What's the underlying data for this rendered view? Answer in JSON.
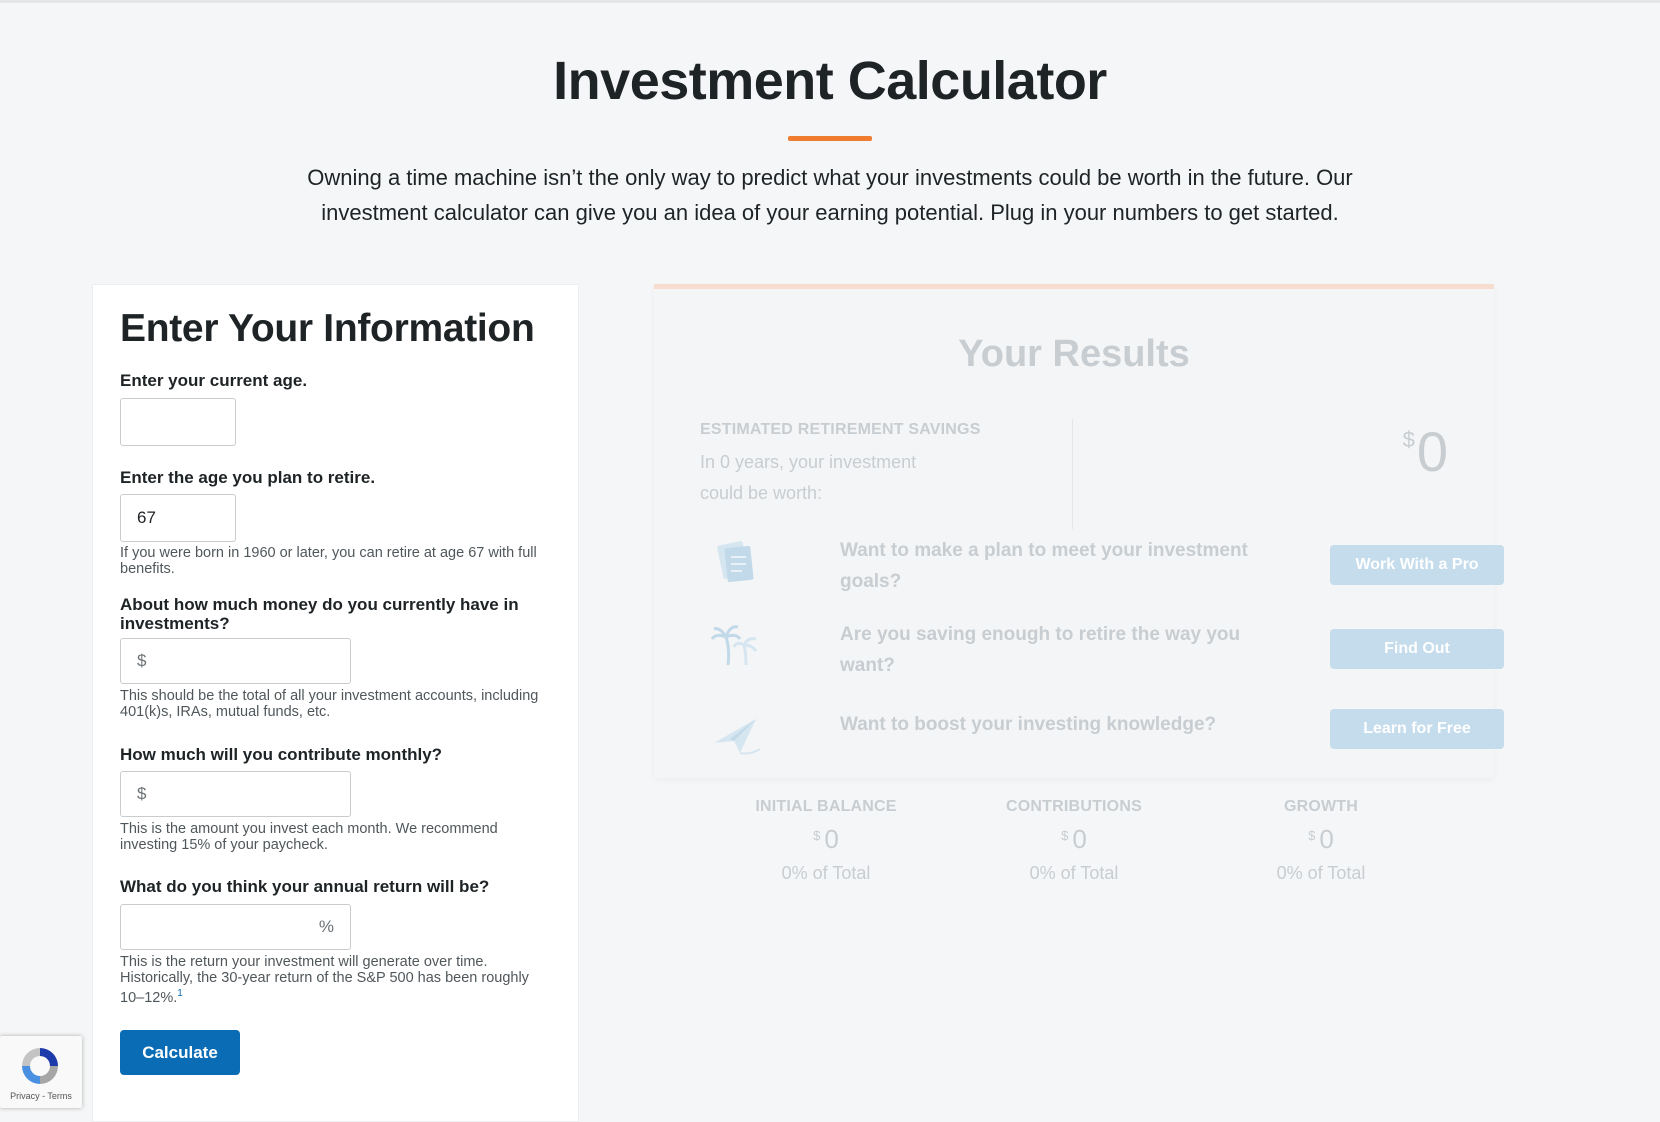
{
  "hero": {
    "title": "Investment Calculator",
    "intro": "Owning a time machine isn’t the only way to predict what your investments could be worth in the future. Our investment calculator can give you an idea of your earning potential. Plug in your numbers to get started."
  },
  "form": {
    "title": "Enter Your Information",
    "current_age": {
      "label": "Enter your current age.",
      "value": ""
    },
    "retire_age": {
      "label": "Enter the age you plan to retire.",
      "value": "67",
      "help": "If you were born in 1960 or later, you can retire at age 67 with full benefits."
    },
    "current_investments": {
      "label": "About how much money do you currently have in investments?",
      "prefix": "$",
      "value": "",
      "help": "This should be the total of all your investment accounts, including 401(k)s, IRAs, mutual funds, etc."
    },
    "monthly_contribution": {
      "label": "How much will you contribute monthly?",
      "prefix": "$",
      "value": "",
      "help": "This is the amount you invest each month. We recommend investing 15% of your paycheck."
    },
    "annual_return": {
      "label": "What do you think your annual return will be?",
      "suffix": "%",
      "value": "",
      "help": "This is the return your investment will generate over time. Historically, the 30-year return of the S&P 500 has been roughly 10–12%.",
      "footnote": "1"
    },
    "calculate_label": "Calculate"
  },
  "results": {
    "title": "Your Results",
    "estimated_label": "ESTIMATED RETIREMENT SAVINGS",
    "estimated_text": "In 0 years, your investment could be worth:",
    "currency": "$",
    "total": "0",
    "ctas": [
      {
        "icon": "checklist-icon",
        "text": "Want to make a plan to meet your investment goals?",
        "button": "Work With a Pro"
      },
      {
        "icon": "palm-trees-icon",
        "text": "Are you saving enough to retire the way you want?",
        "button": "Find Out"
      },
      {
        "icon": "paper-plane-icon",
        "text": "Want to boost your investing knowledge?",
        "button": "Learn for Free"
      }
    ],
    "stats": [
      {
        "label": "INITIAL BALANCE",
        "value": "0",
        "pct": "0% of Total"
      },
      {
        "label": "CONTRIBUTIONS",
        "value": "0",
        "pct": "0% of Total"
      },
      {
        "label": "GROWTH",
        "value": "0",
        "pct": "0% of Total"
      }
    ]
  },
  "recaptcha": {
    "links": "Privacy - Terms"
  },
  "colors": {
    "accent_orange": "#ef7c2f",
    "primary_blue": "#0a6cb4",
    "faded_button": "#c5dcec"
  }
}
